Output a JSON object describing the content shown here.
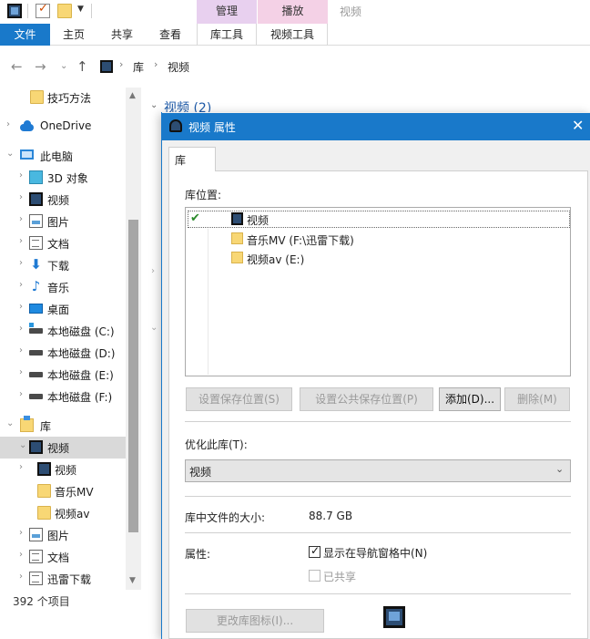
{
  "titlebar": {
    "context_manage": "管理",
    "context_play": "播放",
    "window_title": "视频"
  },
  "ribbon": {
    "file": "文件",
    "home": "主页",
    "share": "共享",
    "view": "查看",
    "library_tools": "库工具",
    "video_tools": "视频工具"
  },
  "address": {
    "parts": [
      "库",
      "视频"
    ]
  },
  "nav": {
    "items": [
      {
        "label": "技巧方法",
        "icon": "folder-icon"
      },
      {
        "label": "OneDrive",
        "icon": "onedrive-cloud-icon"
      },
      {
        "label": "此电脑",
        "icon": "computer-icon"
      },
      {
        "label": "3D 对象",
        "icon": "3d-objects-icon"
      },
      {
        "label": "视频",
        "icon": "video-film-icon"
      },
      {
        "label": "图片",
        "icon": "picture-icon"
      },
      {
        "label": "文档",
        "icon": "document-icon"
      },
      {
        "label": "下载",
        "icon": "download-arrow-icon"
      },
      {
        "label": "音乐",
        "icon": "music-note-icon"
      },
      {
        "label": "桌面",
        "icon": "desktop-icon"
      },
      {
        "label": "本地磁盘 (C:)",
        "icon": "system-drive-icon"
      },
      {
        "label": "本地磁盘 (D:)",
        "icon": "drive-icon"
      },
      {
        "label": "本地磁盘 (E:)",
        "icon": "drive-icon"
      },
      {
        "label": "本地磁盘 (F:)",
        "icon": "drive-icon"
      },
      {
        "label": "库",
        "icon": "libraries-icon"
      },
      {
        "label": "视频",
        "icon": "video-film-icon"
      },
      {
        "label": "视频",
        "icon": "video-film-icon"
      },
      {
        "label": "音乐MV",
        "icon": "folder-icon"
      },
      {
        "label": "视频av",
        "icon": "folder-icon"
      },
      {
        "label": "图片",
        "icon": "picture-icon"
      },
      {
        "label": "文档",
        "icon": "document-icon"
      },
      {
        "label": "迅雷下载",
        "icon": "document-icon"
      }
    ]
  },
  "status": {
    "item_count": "392 个项目"
  },
  "content": {
    "group_header": "视频 (2)"
  },
  "dialog": {
    "title": "视频 属性",
    "tab": "库",
    "locations_label": "库位置:",
    "locations": [
      {
        "label": "视频",
        "icon": "video-film-icon"
      },
      {
        "label": "音乐MV (F:\\迅雷下载)",
        "icon": "folder-icon"
      },
      {
        "label": "视频av (E:)",
        "icon": "folder-icon"
      }
    ],
    "buttons": {
      "set_save": "设置保存位置(S)",
      "set_public_save": "设置公共保存位置(P)",
      "add": "添加(D)...",
      "remove": "删除(M)"
    },
    "optimize_label": "优化此库(T):",
    "optimize_value": "视频",
    "size_label": "库中文件的大小:",
    "size_value": "88.7 GB",
    "attributes_label": "属性:",
    "show_in_nav": "显示在导航窗格中(N)",
    "shared": "已共享",
    "change_icon": "更改库图标(I)..."
  }
}
